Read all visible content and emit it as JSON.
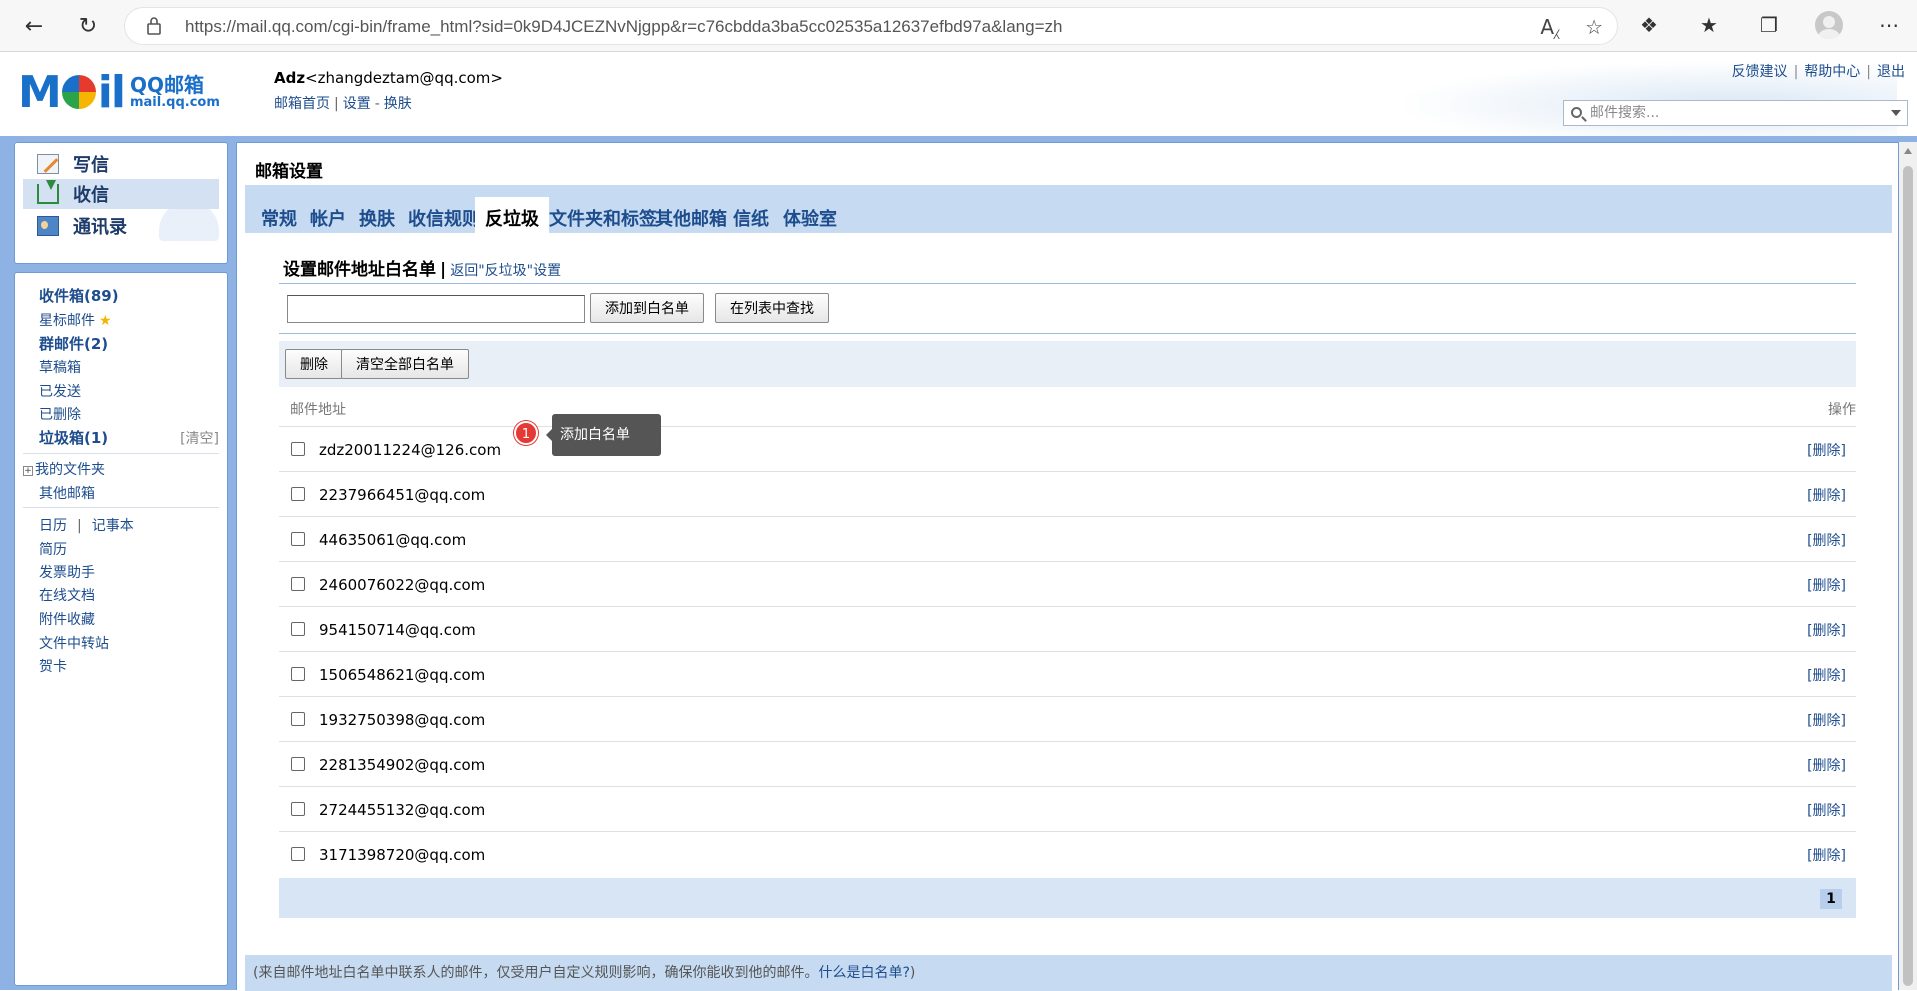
{
  "browser": {
    "url": "https://mail.qq.com/cgi-bin/frame_html?sid=0k9D4JCEZNvNjgpp&r=c76cbdda3ba5cc02535a12637efbd97a&lang=zh"
  },
  "header": {
    "logo_text": "M",
    "logo_text2": "il",
    "logo_sub_a": "QQ邮箱",
    "logo_sub_b": "mail.qq.com",
    "user_name": "Adz",
    "user_email": "<zhangdeztam@qq.com>",
    "link_home": "邮箱首页",
    "link_settings": "设置",
    "link_skin": "换肤",
    "top_feedback": "反馈建议",
    "top_help": "帮助中心",
    "top_logout": "退出",
    "search_placeholder": "邮件搜索..."
  },
  "left_top": {
    "write": "写信",
    "inbox": "收信",
    "contacts": "通讯录"
  },
  "folders": {
    "inbox": "收件箱(89)",
    "starred": "星标邮件",
    "group": "群邮件(2)",
    "drafts": "草稿箱",
    "sent": "已发送",
    "deleted": "已删除",
    "spam": "垃圾箱(1)",
    "spam_clear": "[清空]",
    "my_folders": "我的文件夹",
    "other_mail": "其他邮箱",
    "calendar": "日历",
    "notepad": "记事本",
    "resume": "简历",
    "invoice": "发票助手",
    "docs": "在线文档",
    "attachments": "附件收藏",
    "transfer": "文件中转站",
    "cards": "贺卡"
  },
  "main": {
    "page_title": "邮箱设置",
    "tabs": [
      "常规",
      "帐户",
      "换肤",
      "收信规则",
      "反垃圾",
      "文件夹和标签",
      "其他邮箱",
      "信纸",
      "体验室"
    ],
    "active_tab": "反垃圾",
    "section_title": "设置邮件地址白名单",
    "back_link": "返回\"反垃圾\"设置",
    "add_button": "添加到白名单",
    "find_button": "在列表中查找",
    "delete_button": "删除",
    "clear_button": "清空全部白名单",
    "col_address": "邮件地址",
    "col_action": "操作",
    "rows": [
      {
        "address": "zdz20011224@126.com",
        "action": "[删除]"
      },
      {
        "address": "2237966451@qq.com",
        "action": "[删除]"
      },
      {
        "address": "44635061@qq.com",
        "action": "[删除]"
      },
      {
        "address": "2460076022@qq.com",
        "action": "[删除]"
      },
      {
        "address": "954150714@qq.com",
        "action": "[删除]"
      },
      {
        "address": "1506548621@qq.com",
        "action": "[删除]"
      },
      {
        "address": "1932750398@qq.com",
        "action": "[删除]"
      },
      {
        "address": "2281354902@qq.com",
        "action": "[删除]"
      },
      {
        "address": "2724455132@qq.com",
        "action": "[删除]"
      },
      {
        "address": "3171398720@qq.com",
        "action": "[删除]"
      }
    ],
    "page_number": "1",
    "tooltip_badge": "1",
    "tooltip_text": "添加白名单",
    "footer_text": "(来自邮件地址白名单中联系人的邮件，仅受用户自定义规则影响，确保你能收到他的邮件。",
    "footer_link": "什么是白名单?",
    "footer_end": ")"
  }
}
